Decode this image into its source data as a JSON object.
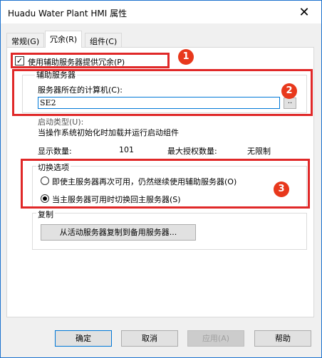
{
  "window": {
    "title": "Huadu Water Plant HMI 属性",
    "close_glyph": "✕"
  },
  "tabs": [
    {
      "label": "常规(G)"
    },
    {
      "label": "冗余(R)"
    },
    {
      "label": "组件(C)"
    }
  ],
  "redundancy": {
    "use_aux_checkbox_label": "使用辅助服务器提供冗余(P)",
    "use_aux_checked": true,
    "aux_server_group": "辅助服务器",
    "server_computer_label": "服务器所在的计算机(C):",
    "server_computer_value": "SE2",
    "browse_button": "..",
    "startup_type_label": "启动类型(U):",
    "startup_type_value": "当操作系统初始化时加载并运行启动组件",
    "display_count_label": "显示数量:",
    "display_count_value": "101",
    "max_license_label": "最大授权数量:",
    "max_license_value": "无限制",
    "switch_group": "切换选项",
    "switch_options": [
      {
        "label": "即使主服务器再次可用，仍然继续使用辅助服务器(O)",
        "checked": false
      },
      {
        "label": "当主服务器可用时切换回主服务器(S)",
        "checked": true
      }
    ],
    "copy_group": "复制",
    "copy_button": "从活动服务器复制到备用服务器..."
  },
  "annotations": {
    "badge1": "1",
    "badge2": "2",
    "badge3": "3",
    "color": "#e02828"
  },
  "footer": {
    "ok": "确定",
    "cancel": "取消",
    "apply": "应用(A)",
    "help": "帮助"
  }
}
